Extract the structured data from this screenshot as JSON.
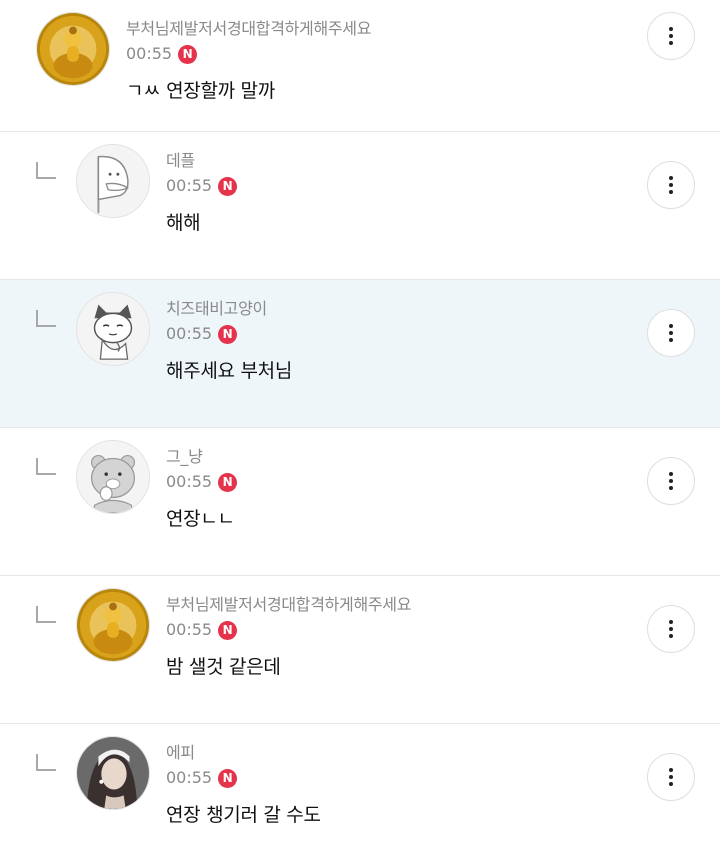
{
  "comments": [
    {
      "nickname": "부처님제발저서경대합격하게해주세요",
      "time": "00:55",
      "badge": "N",
      "text": "ㄱㅆ 연장할까 말까",
      "avatar_icon": "buddha-avatar-icon",
      "is_reply": false,
      "highlighted": false
    },
    {
      "nickname": "데플",
      "time": "00:55",
      "badge": "N",
      "text": "해해",
      "avatar_icon": "peeking-character-avatar-icon",
      "is_reply": true,
      "highlighted": false
    },
    {
      "nickname": "치즈태비고양이",
      "time": "00:55",
      "badge": "N",
      "text": "해주세요 부처님",
      "avatar_icon": "cat-character-avatar-icon",
      "is_reply": true,
      "highlighted": true
    },
    {
      "nickname": "그_냥",
      "time": "00:55",
      "badge": "N",
      "text": "연장ㄴㄴ",
      "avatar_icon": "bear-character-avatar-icon",
      "is_reply": true,
      "highlighted": false
    },
    {
      "nickname": "부처님제발저서경대합격하게해주세요",
      "time": "00:55",
      "badge": "N",
      "text": "밤 샐것 같은데",
      "avatar_icon": "buddha-avatar-icon",
      "is_reply": true,
      "highlighted": false
    },
    {
      "nickname": "에피",
      "time": "00:55",
      "badge": "N",
      "text": "연장 챙기러 갈 수도",
      "avatar_icon": "person-photo-avatar-icon",
      "is_reply": true,
      "highlighted": false
    }
  ],
  "colors": {
    "badge": "#e6334c",
    "highlight_row": "#eff6fa",
    "meta_text": "#8a8a8a",
    "body_text": "#111111"
  }
}
